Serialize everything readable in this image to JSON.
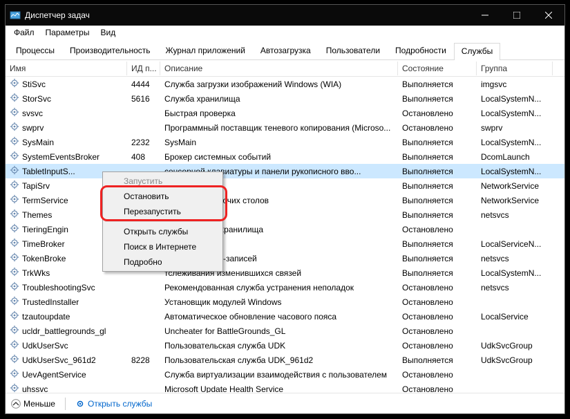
{
  "titlebar": {
    "title": "Диспетчер задач"
  },
  "menubar": {
    "file": "Файл",
    "options": "Параметры",
    "view": "Вид"
  },
  "tabs": [
    {
      "label": "Процессы"
    },
    {
      "label": "Производительность"
    },
    {
      "label": "Журнал приложений"
    },
    {
      "label": "Автозагрузка"
    },
    {
      "label": "Пользователи"
    },
    {
      "label": "Подробности"
    },
    {
      "label": "Службы"
    }
  ],
  "columns": {
    "name": "Имя",
    "pid": "ИД п...",
    "desc": "Описание",
    "state": "Состояние",
    "group": "Группа"
  },
  "services": [
    {
      "name": "StiSvc",
      "pid": "4444",
      "desc": "Служба загрузки изображений Windows (WIA)",
      "state": "Выполняется",
      "group": "imgsvc"
    },
    {
      "name": "StorSvc",
      "pid": "5616",
      "desc": "Служба хранилища",
      "state": "Выполняется",
      "group": "LocalSystemN..."
    },
    {
      "name": "svsvc",
      "pid": "",
      "desc": "Быстрая проверка",
      "state": "Остановлено",
      "group": "LocalSystemN..."
    },
    {
      "name": "swprv",
      "pid": "",
      "desc": "Программный поставщик теневого копирования (Microso...",
      "state": "Остановлено",
      "group": "swprv"
    },
    {
      "name": "SysMain",
      "pid": "2232",
      "desc": "SysMain",
      "state": "Выполняется",
      "group": "LocalSystemN..."
    },
    {
      "name": "SystemEventsBroker",
      "pid": "408",
      "desc": "Брокер системных событий",
      "state": "Выполняется",
      "group": "DcomLaunch"
    },
    {
      "name": "TabletInputS...",
      "pid": "",
      "desc": "            сенсорной клавиатуры и панели рукописного вво...",
      "state": "Выполняется",
      "group": "LocalSystemN...",
      "selected": true
    },
    {
      "name": "TapiSrv",
      "pid": "",
      "desc": "",
      "state": "Выполняется",
      "group": "NetworkService"
    },
    {
      "name": "TermService",
      "pid": "",
      "desc": "         удаленных рабочих столов",
      "state": "Выполняется",
      "group": "NetworkService"
    },
    {
      "name": "Themes",
      "pid": "",
      "desc": "",
      "state": "Выполняется",
      "group": "netsvcs"
    },
    {
      "name": "TieringEngin",
      "pid": "",
      "desc": "              ния уровнями хранилища",
      "state": "Остановлено",
      "group": ""
    },
    {
      "name": "TimeBroker",
      "pid": "",
      "desc": "               ремени",
      "state": "Выполняется",
      "group": "LocalServiceN..."
    },
    {
      "name": "TokenBroke",
      "pid": "",
      "desc": "              ер учетных веб-записей",
      "state": "Выполняется",
      "group": "netsvcs"
    },
    {
      "name": "TrkWks",
      "pid": "",
      "desc": "               тслеживания изменившихся связей",
      "state": "Выполняется",
      "group": "LocalSystemN..."
    },
    {
      "name": "TroubleshootingSvc",
      "pid": "",
      "desc": "Рекомендованная служба устранения неполадок",
      "state": "Остановлено",
      "group": "netsvcs"
    },
    {
      "name": "TrustedInstaller",
      "pid": "",
      "desc": "Установщик модулей Windows",
      "state": "Остановлено",
      "group": ""
    },
    {
      "name": "tzautoupdate",
      "pid": "",
      "desc": "Автоматическое обновление часового пояса",
      "state": "Остановлено",
      "group": "LocalService"
    },
    {
      "name": "ucldr_battlegrounds_gl",
      "pid": "",
      "desc": "Uncheater for BattleGrounds_GL",
      "state": "Остановлено",
      "group": ""
    },
    {
      "name": "UdkUserSvc",
      "pid": "",
      "desc": "Пользовательская служба UDK",
      "state": "Остановлено",
      "group": "UdkSvcGroup"
    },
    {
      "name": "UdkUserSvc_961d2",
      "pid": "8228",
      "desc": "Пользовательская служба UDK_961d2",
      "state": "Выполняется",
      "group": "UdkSvcGroup"
    },
    {
      "name": "UevAgentService",
      "pid": "",
      "desc": "Служба виртуализации взаимодействия с пользователем",
      "state": "Остановлено",
      "group": ""
    },
    {
      "name": "uhssvc",
      "pid": "",
      "desc": "Microsoft Update Health Service",
      "state": "Остановлено",
      "group": ""
    }
  ],
  "context_menu": {
    "start": "Запустить",
    "stop": "Остановить",
    "restart": "Перезапустить",
    "open_services": "Открыть службы",
    "search_online": "Поиск в Интернете",
    "details": "Подробно"
  },
  "statusbar": {
    "fewer": "Меньше",
    "open_services": "Открыть службы"
  }
}
